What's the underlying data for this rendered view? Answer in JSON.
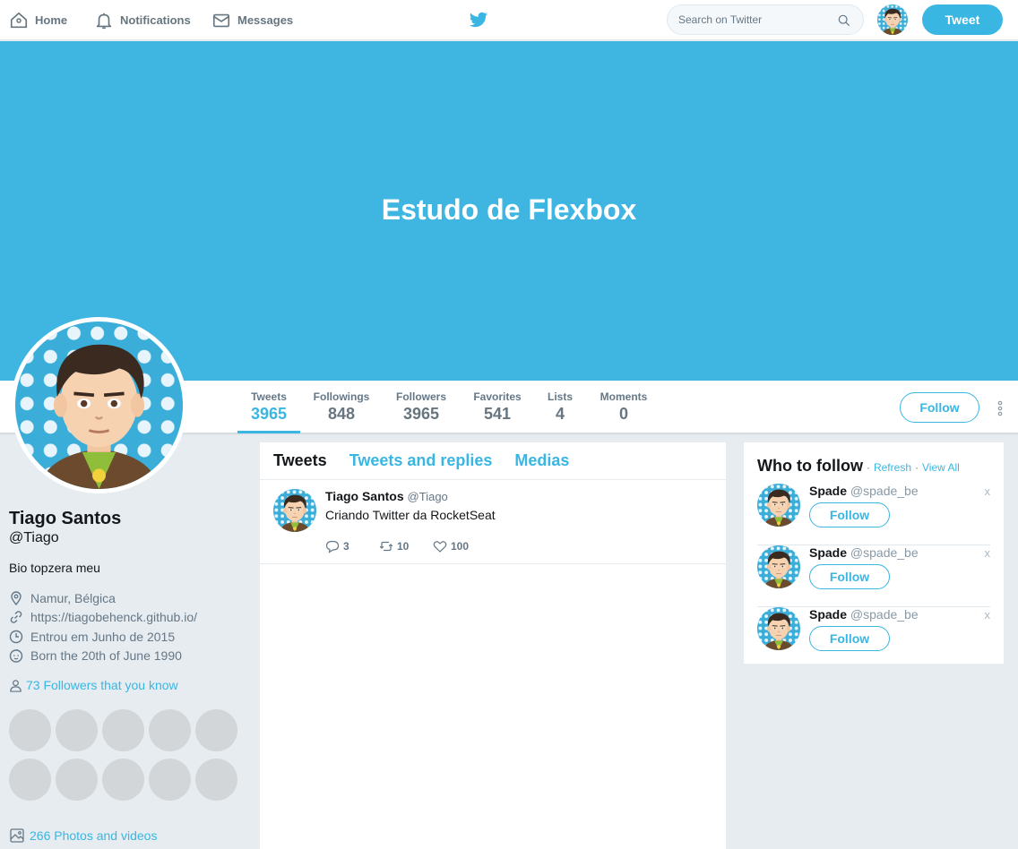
{
  "nav": {
    "home": "Home",
    "notifications": "Notifications",
    "messages": "Messages",
    "search_placeholder": "Search on Twitter",
    "tweet_button": "Tweet"
  },
  "banner": {
    "title": "Estudo de Flexbox"
  },
  "stats": [
    {
      "label": "Tweets",
      "value": "3965"
    },
    {
      "label": "Followings",
      "value": "848"
    },
    {
      "label": "Followers",
      "value": "3965"
    },
    {
      "label": "Favorites",
      "value": "541"
    },
    {
      "label": "Lists",
      "value": "4"
    },
    {
      "label": "Moments",
      "value": "0"
    }
  ],
  "profile": {
    "follow_button": "Follow",
    "name": "Tiago Santos",
    "handle": "@Tiago",
    "bio": "Bio topzera meu",
    "location": "Namur, Bélgica",
    "website": "https://tiagobehenck.github.io/",
    "joined": "Entrou em Junho de 2015",
    "born": "Born the 20th of June 1990",
    "followers_you_know": "73 Followers that you know",
    "photos_videos": "266 Photos and videos"
  },
  "tabs": [
    "Tweets",
    "Tweets and replies",
    "Medias"
  ],
  "tweet": {
    "author": "Tiago Santos",
    "handle": "@Tiago",
    "text": "Criando Twitter da RocketSeat",
    "replies": "3",
    "retweets": "10",
    "likes": "100"
  },
  "who_to_follow": {
    "title": "Who to follow",
    "sep": "·",
    "refresh": "Refresh",
    "view_all": "View All",
    "suggestions": [
      {
        "name": "Spade",
        "handle": "@spade_be",
        "button": "Follow",
        "close": "x"
      },
      {
        "name": "Spade",
        "handle": "@spade_be",
        "button": "Follow",
        "close": "x"
      },
      {
        "name": "Spade",
        "handle": "@spade_be",
        "button": "Follow",
        "close": "x"
      }
    ]
  },
  "colors": {
    "accent": "#3ab6e2",
    "banner": "#3eb6e1",
    "background": "#e6ecf0"
  }
}
